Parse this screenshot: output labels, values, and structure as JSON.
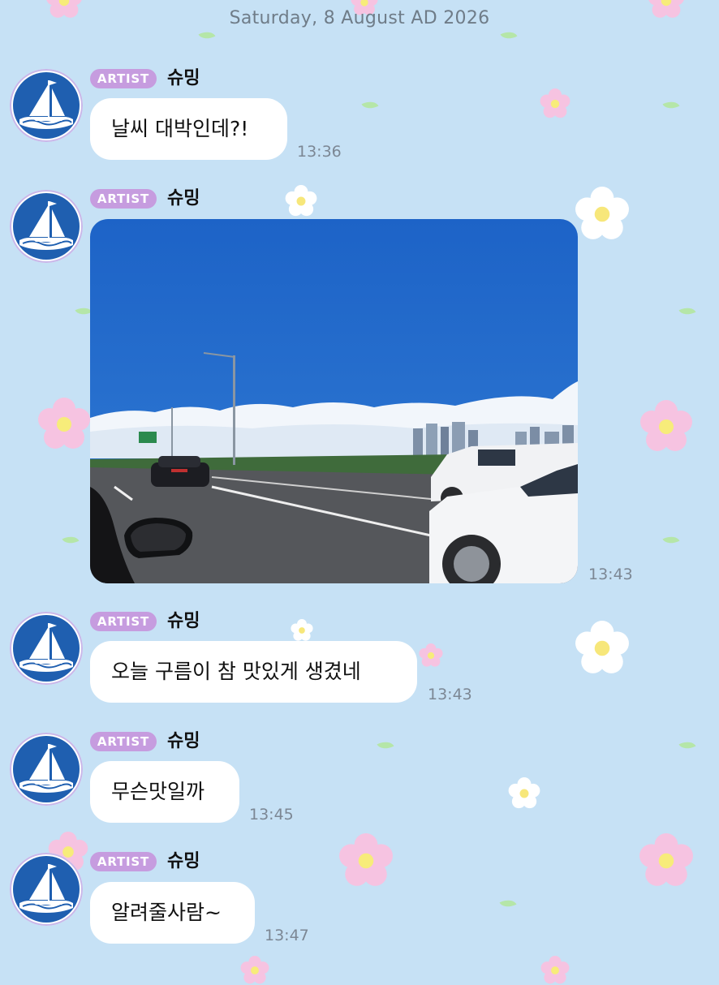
{
  "date_separator": "Saturday, 8 August AD 2026",
  "sender": {
    "badge": "ARTIST",
    "name": "슈밍",
    "avatar_icon": "sailboat-avatar-icon"
  },
  "messages": [
    {
      "type": "text",
      "text": "날씨 대박인데?!",
      "time": "13:36"
    },
    {
      "type": "image",
      "image_icon": "road-sky-clouds-photo",
      "time": "13:43"
    },
    {
      "type": "text",
      "text": "오늘 구름이 참 맛있게 생겼네",
      "time": "13:43"
    },
    {
      "type": "text",
      "text": "무슨맛일까",
      "time": "13:45"
    },
    {
      "type": "text",
      "text": "알려줄사람~",
      "time": "13:47"
    }
  ],
  "colors": {
    "background": "#c6e1f5",
    "badge": "#c69cdf",
    "bubble": "#ffffff",
    "timestamp": "#7c8794"
  }
}
